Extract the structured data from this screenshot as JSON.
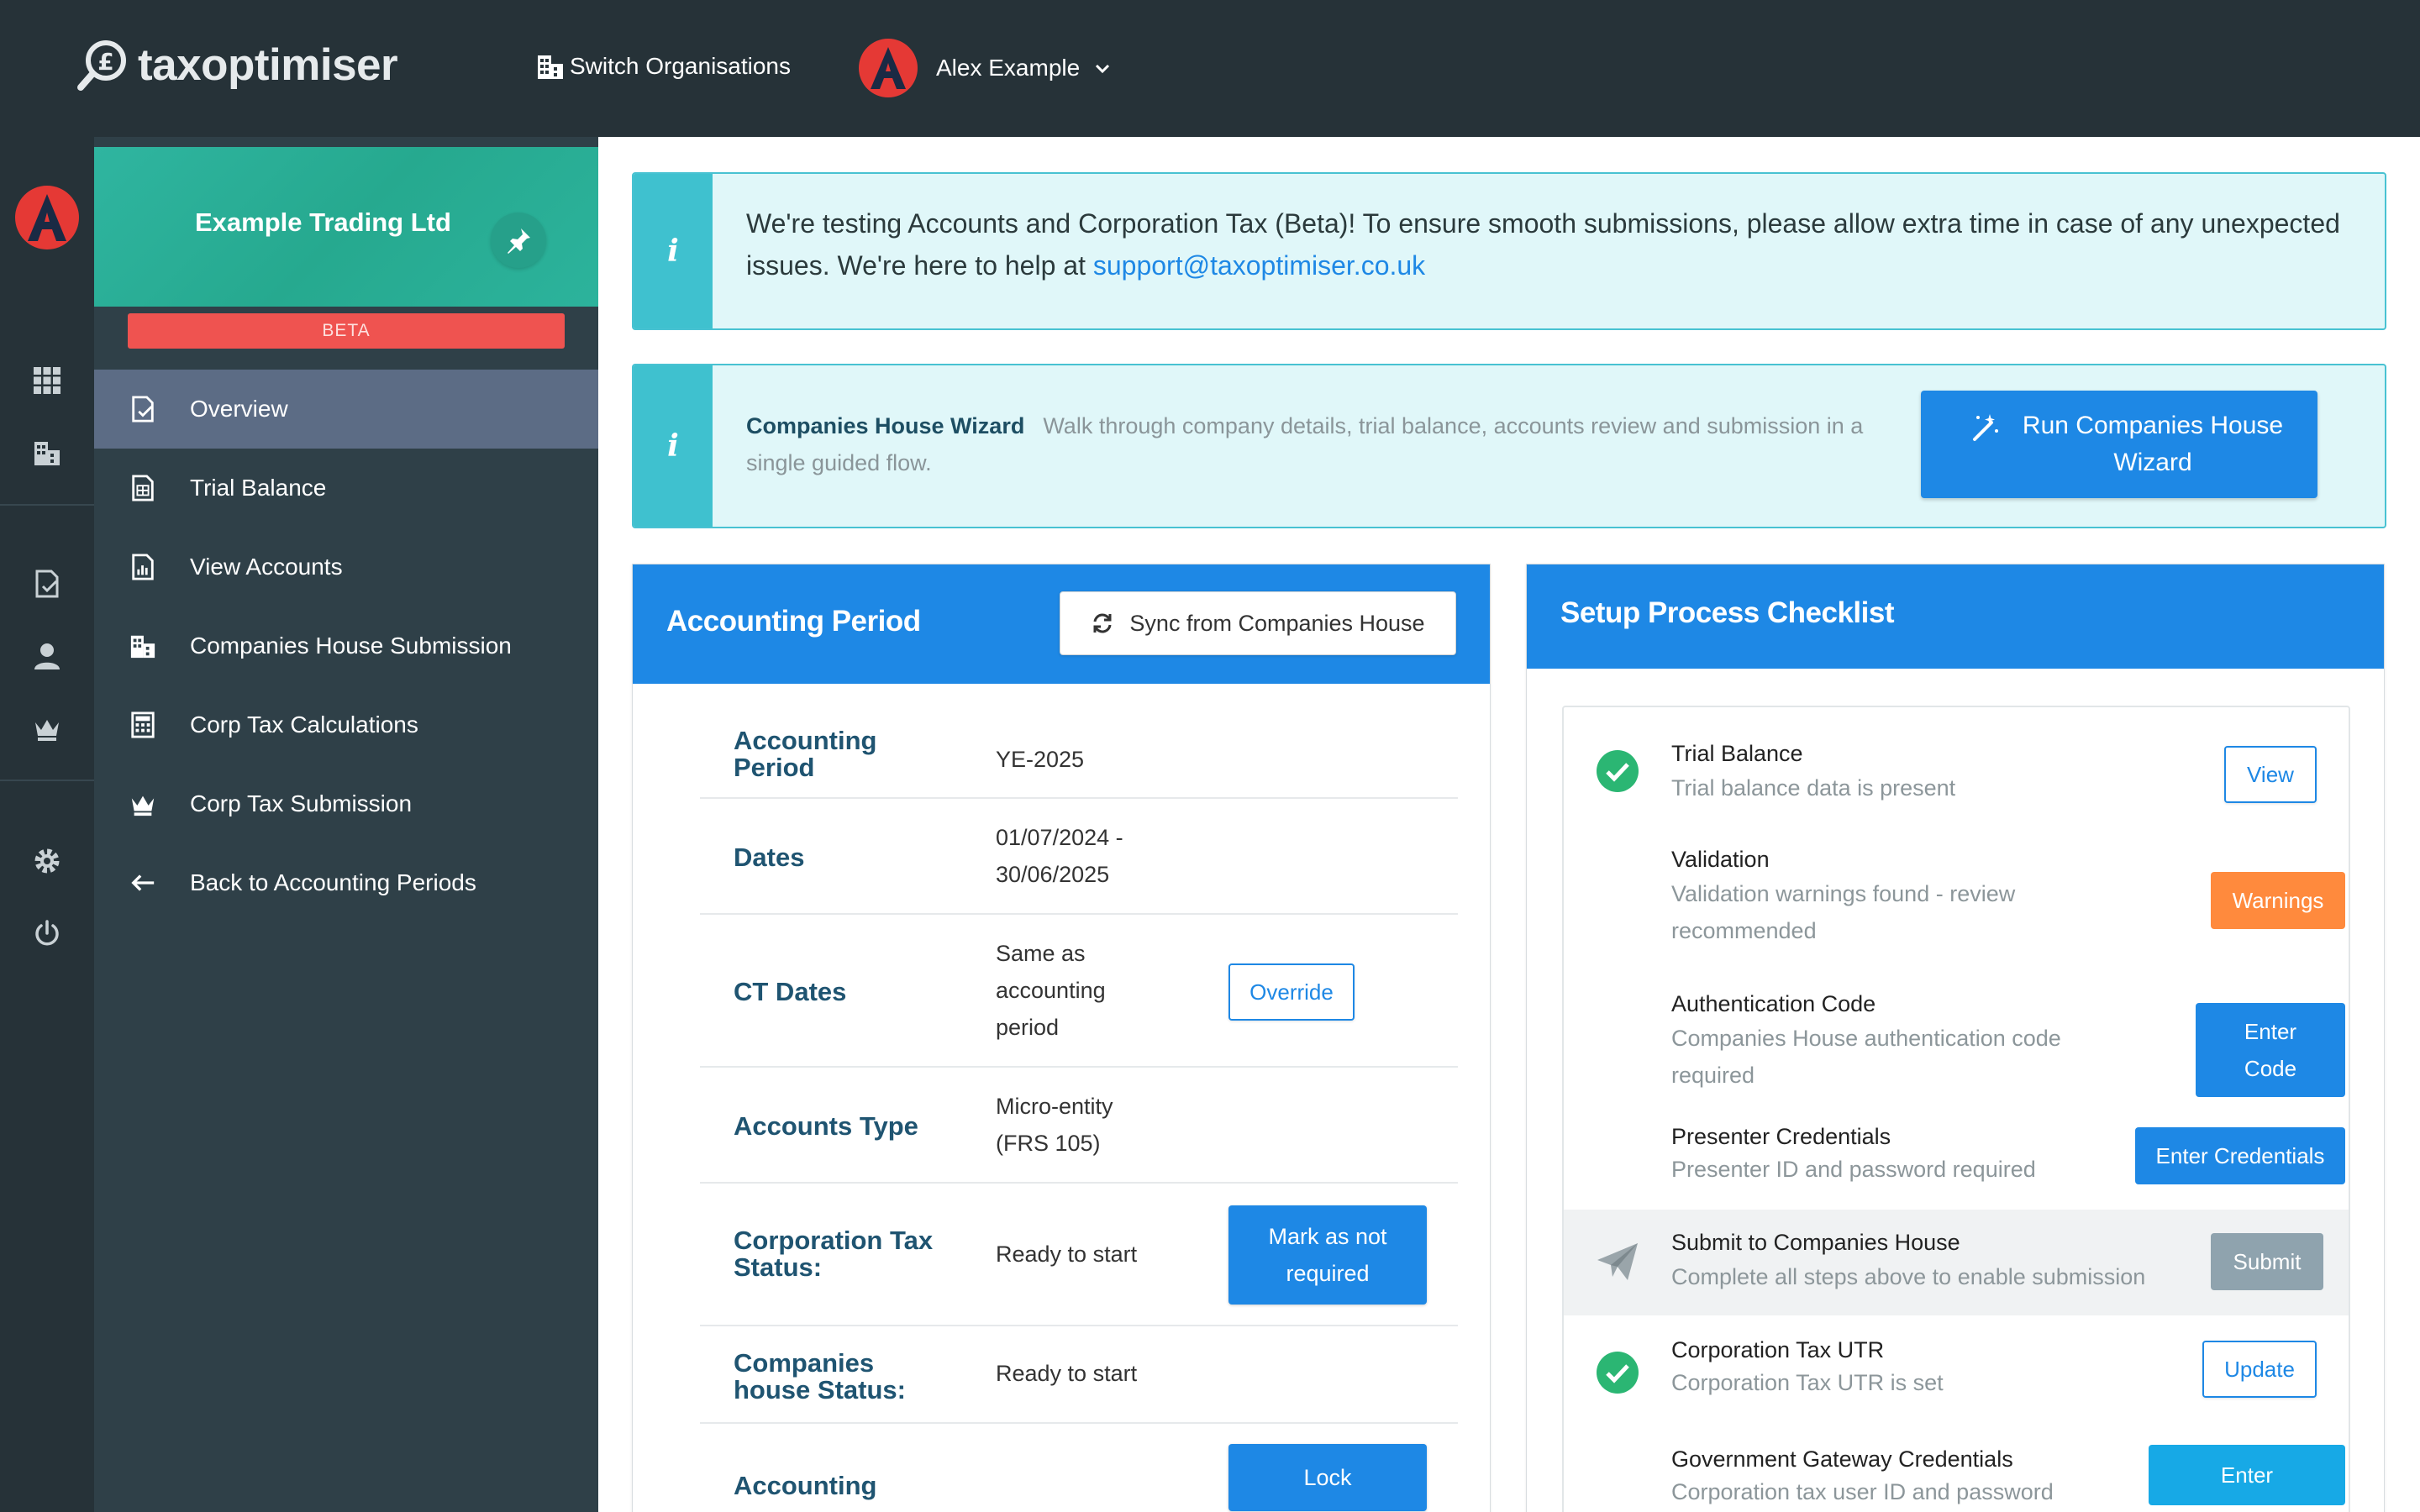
{
  "topbar": {
    "logo_text": "taxoptimiser",
    "switch_org_label": "Switch Organisations",
    "user_name": "Alex Example"
  },
  "sidebar": {
    "org_name": "Example Trading Ltd",
    "beta_label": "BETA",
    "items": [
      {
        "label": "Overview",
        "icon": "document-check-icon"
      },
      {
        "label": "Trial Balance",
        "icon": "spreadsheet-icon"
      },
      {
        "label": "View Accounts",
        "icon": "report-chart-icon"
      },
      {
        "label": "Companies House Submission",
        "icon": "buildings-icon"
      },
      {
        "label": "Corp Tax Calculations",
        "icon": "calculator-icon"
      },
      {
        "label": "Corp Tax Submission",
        "icon": "crown-icon"
      },
      {
        "label": "Back to Accounting Periods",
        "icon": "arrow-left-icon"
      }
    ]
  },
  "alerts": {
    "beta": {
      "text": "We're testing Accounts and Corporation Tax (Beta)! To ensure smooth submissions, please allow extra time in case of any unexpected issues. We're here to help at ",
      "email": "support@taxoptimiser.co.uk"
    },
    "wizard": {
      "title": "Companies House Wizard",
      "text": "Walk through company details, trial balance, accounts review and submission in a single guided flow.",
      "button": "Run Companies House Wizard"
    }
  },
  "period_card": {
    "title": "Accounting Period",
    "sync_button": "Sync from Companies House",
    "rows": {
      "period": {
        "label": "Accounting Period",
        "value": "YE-2025"
      },
      "dates": {
        "label": "Dates",
        "value": "01/07/2024 - 30/06/2025"
      },
      "ct_dates": {
        "label": "CT Dates",
        "value": "Same as accounting period",
        "button": "Override"
      },
      "accounts_type": {
        "label": "Accounts Type",
        "value": "Micro-entity (FRS 105)"
      },
      "ct_status": {
        "label": "Corporation Tax Status:",
        "value": "Ready to start",
        "button": "Mark as not required"
      },
      "ch_status": {
        "label": "Companies house Status:",
        "value": "Ready to start"
      },
      "accounting": {
        "label": "Accounting",
        "button": "Lock"
      }
    }
  },
  "checklist": {
    "title": "Setup Process Checklist",
    "items": {
      "trial_balance": {
        "title": "Trial Balance",
        "desc": "Trial balance data is present",
        "button": "View"
      },
      "validation": {
        "title": "Validation",
        "desc": "Validation warnings found - review recommended",
        "button": "Warnings"
      },
      "auth_code": {
        "title": "Authentication Code",
        "desc": "Companies House authentication code required",
        "button": "Enter Code"
      },
      "presenter": {
        "title": "Presenter Credentials",
        "desc": "Presenter ID and password required",
        "button": "Enter Credentials"
      },
      "submit": {
        "title": "Submit to Companies House",
        "desc": "Complete all steps above to enable submission",
        "button": "Submit"
      },
      "utr": {
        "title": "Corporation Tax UTR",
        "desc": "Corporation Tax UTR is set",
        "button": "Update"
      },
      "gateway": {
        "title": "Government Gateway Credentials",
        "desc": "Corporation tax user ID and password",
        "button": "Enter"
      }
    }
  },
  "colors": {
    "topbar": "#263238",
    "sidebar": "#2f4048",
    "active_nav": "#5c6c85",
    "primary": "#1e88e5",
    "info": "#3fc1cf",
    "beta": "#ef5350",
    "warning": "#ff8a3d",
    "success": "#2bb673"
  }
}
